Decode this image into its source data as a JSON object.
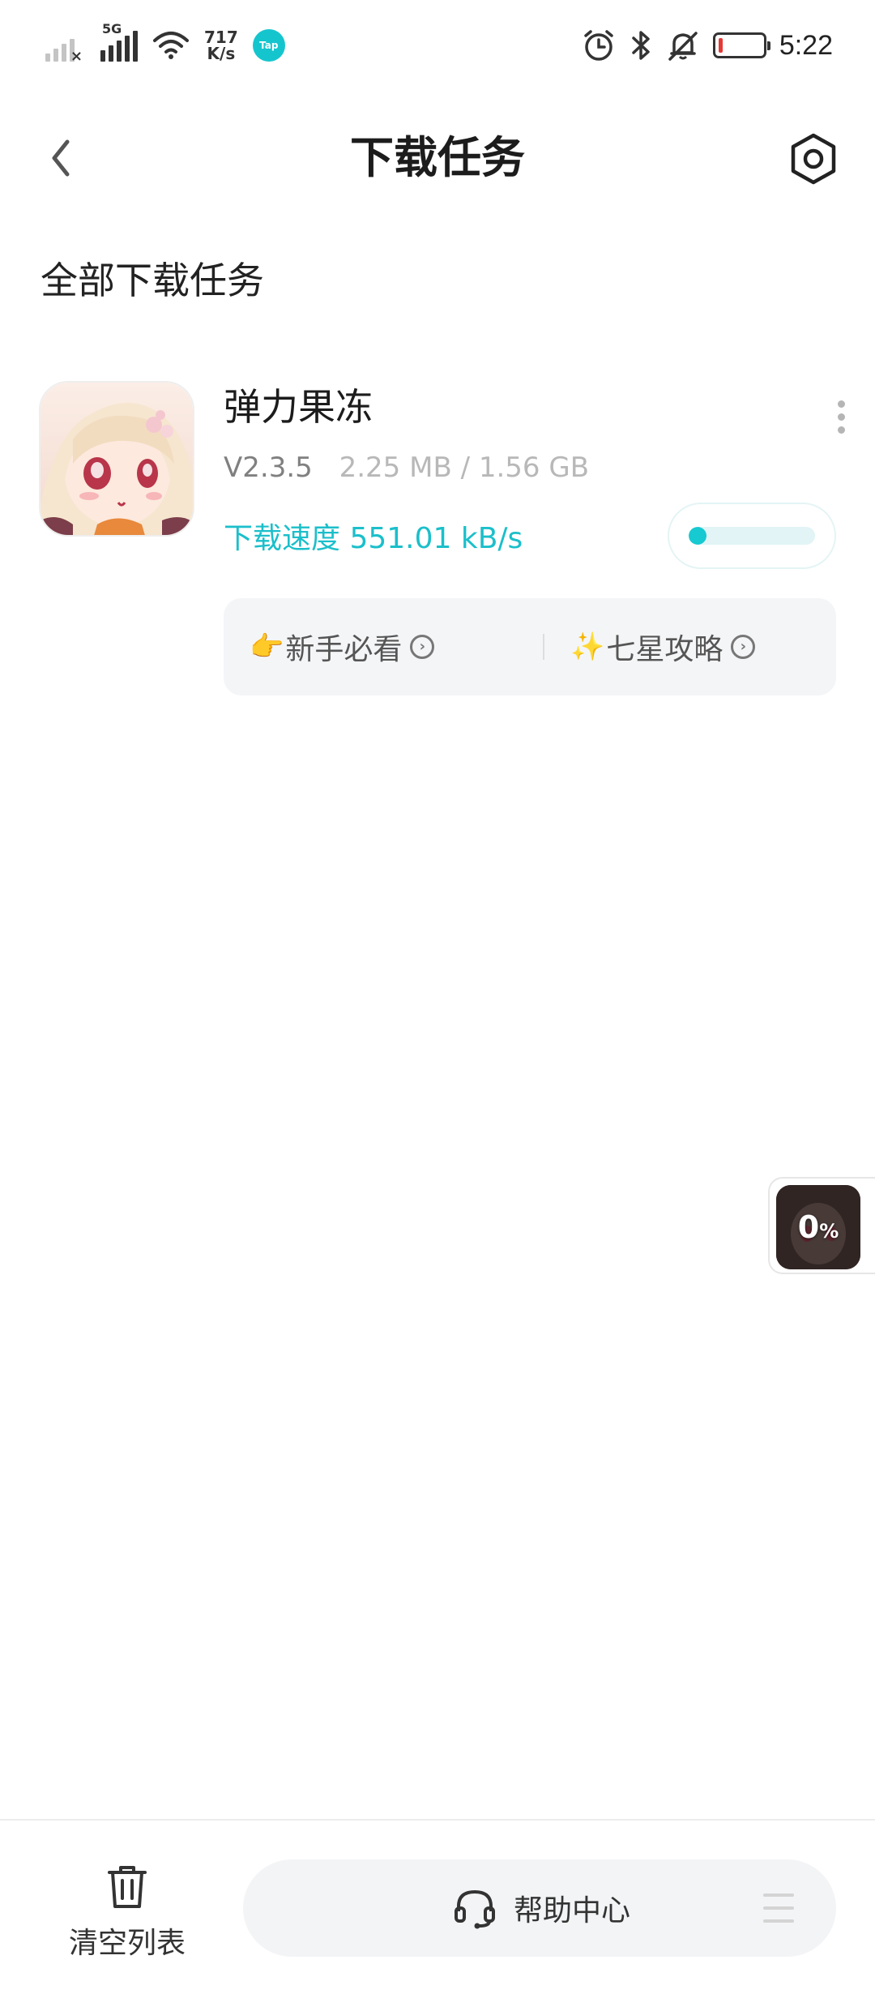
{
  "status_bar": {
    "network_type": "5G",
    "net_speed_value": "717",
    "net_speed_unit": "K/s",
    "app_badge": "Tap",
    "time": "5:22",
    "battery_fraction": 0.1
  },
  "header": {
    "title": "下载任务",
    "back_icon": "chevron-left-icon",
    "settings_icon": "hexagon-settings-icon"
  },
  "section_title": "全部下载任务",
  "task": {
    "name": "弹力果冻",
    "version": "V2.3.5",
    "size": "2.25 MB / 1.56 GB",
    "speed": "下载速度 551.01 kB/s",
    "progress_fraction": 0.0014,
    "accent_color": "#1bbfca",
    "guides": [
      {
        "emoji": "👉",
        "label": "新手必看"
      },
      {
        "emoji": "✨",
        "label": "七星攻略"
      }
    ]
  },
  "float_widget": {
    "percent_value": "0",
    "percent_sign": "%"
  },
  "bottom_bar": {
    "clear_label": "清空列表",
    "help_label": "帮助中心"
  }
}
